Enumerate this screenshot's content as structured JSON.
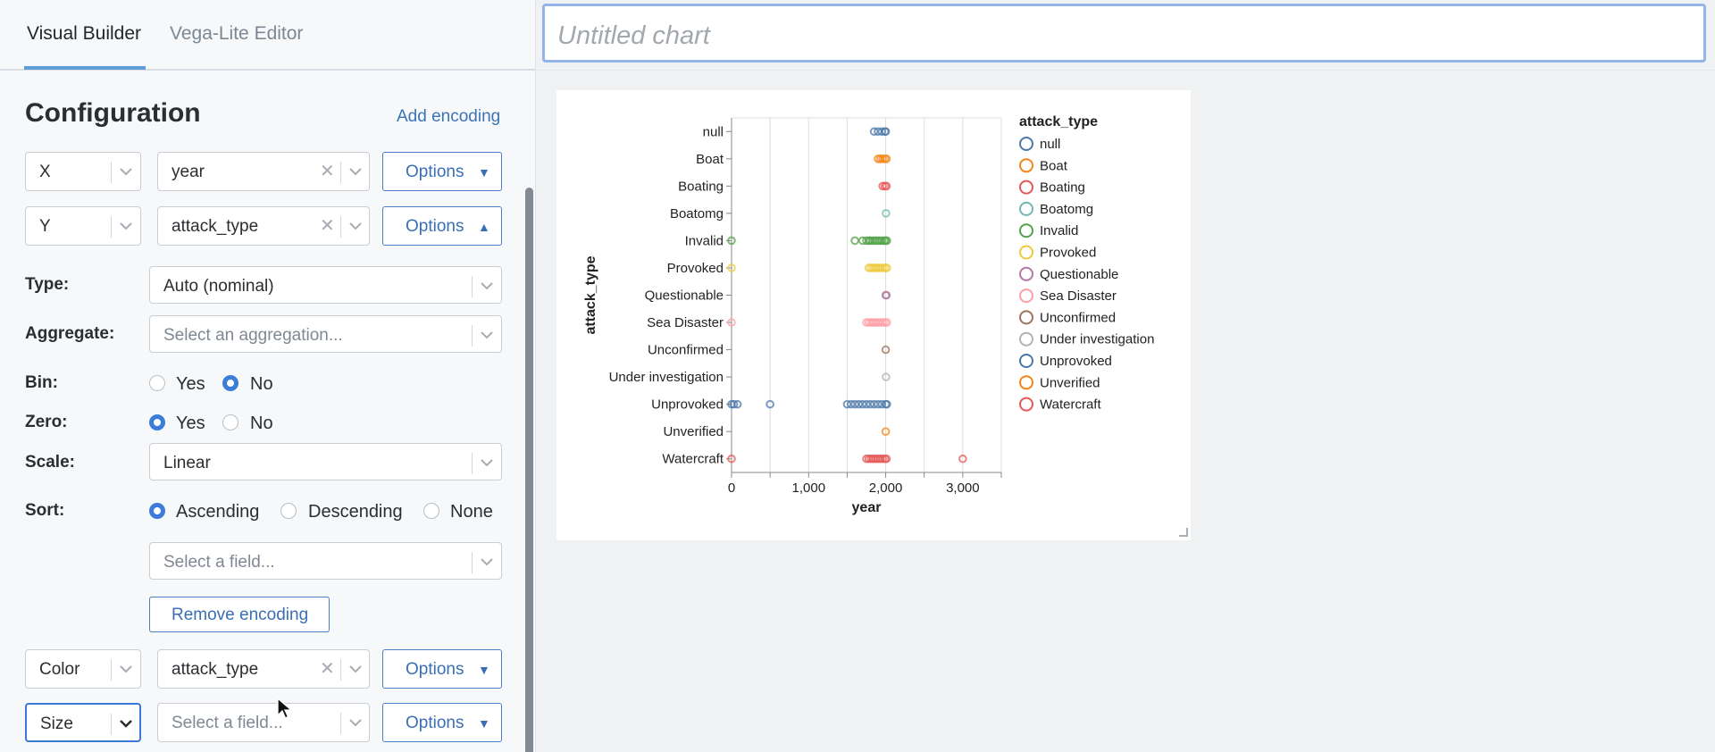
{
  "tabs": {
    "visual": "Visual Builder",
    "vega": "Vega-Lite Editor"
  },
  "config": {
    "title": "Configuration",
    "add_encoding": "Add encoding"
  },
  "encodings": {
    "x": {
      "channel": "X",
      "field": "year",
      "options": "Options"
    },
    "y": {
      "channel": "Y",
      "field": "attack_type",
      "options": "Options"
    },
    "color": {
      "channel": "Color",
      "field": "attack_type",
      "options": "Options"
    },
    "size": {
      "channel": "Size",
      "field_placeholder": "Select a field...",
      "options": "Options"
    }
  },
  "y_options": {
    "type_label": "Type:",
    "type_value": "Auto (nominal)",
    "aggregate_label": "Aggregate:",
    "aggregate_placeholder": "Select an aggregation...",
    "bin_label": "Bin:",
    "bin_yes": "Yes",
    "bin_no": "No",
    "bin_selected": "No",
    "zero_label": "Zero:",
    "zero_yes": "Yes",
    "zero_no": "No",
    "zero_selected": "Yes",
    "scale_label": "Scale:",
    "scale_value": "Linear",
    "sort_label": "Sort:",
    "sort_asc": "Ascending",
    "sort_desc": "Descending",
    "sort_none": "None",
    "sort_selected": "Ascending",
    "sort_field_placeholder": "Select a field...",
    "remove": "Remove encoding"
  },
  "chart_title_placeholder": "Untitled chart",
  "colors": {
    "accent": "#3b7dd8",
    "button_border": "#4a7fc1"
  },
  "chart_data": {
    "type": "scatter",
    "title": "",
    "xlabel": "year",
    "ylabel": "attack_type",
    "xlim": [
      0,
      3500
    ],
    "x_ticks": [
      "0",
      "1,000",
      "2,000",
      "3,000"
    ],
    "legend_title": "attack_type",
    "legend_position": "right",
    "grid": true,
    "categories": [
      "null",
      "Boat",
      "Boating",
      "Boatomg",
      "Invalid",
      "Provoked",
      "Questionable",
      "Sea Disaster",
      "Unconfirmed",
      "Under investigation",
      "Unprovoked",
      "Unverified",
      "Watercraft"
    ],
    "series": [
      {
        "name": "null",
        "color": "#4c78a8",
        "points": [
          1850,
          1900,
          1950,
          1990,
          2000
        ]
      },
      {
        "name": "Boat",
        "color": "#f58518",
        "points": [
          1900,
          1930,
          1960,
          1990,
          2010
        ]
      },
      {
        "name": "Boating",
        "color": "#e45756",
        "points": [
          1960,
          1990,
          2010
        ]
      },
      {
        "name": "Boatomg",
        "color": "#72b7b2",
        "points": [
          2004
        ]
      },
      {
        "name": "Invalid",
        "color": "#54a24b",
        "points": [
          0,
          1600,
          1700,
          1750,
          1780,
          1800,
          1830,
          1860,
          1890,
          1920,
          1950,
          1980,
          2000,
          2015
        ]
      },
      {
        "name": "Provoked",
        "color": "#eeca3b",
        "points": [
          0,
          1780,
          1810,
          1840,
          1870,
          1900,
          1930,
          1960,
          1990,
          2015
        ]
      },
      {
        "name": "Questionable",
        "color": "#b279a2",
        "points": [
          2000,
          2010
        ]
      },
      {
        "name": "Sea Disaster",
        "color": "#ff9da6",
        "points": [
          0,
          1750,
          1780,
          1810,
          1840,
          1870,
          1900,
          1930,
          1960,
          1990,
          2015
        ]
      },
      {
        "name": "Unconfirmed",
        "color": "#9d755d",
        "points": [
          2000
        ]
      },
      {
        "name": "Under investigation",
        "color": "#bab0ac",
        "points": [
          2004
        ]
      },
      {
        "name": "Unprovoked",
        "color": "#4c78a8",
        "points": [
          0,
          30,
          77,
          500,
          1500,
          1550,
          1600,
          1650,
          1700,
          1750,
          1800,
          1850,
          1900,
          1950,
          2000,
          2015
        ]
      },
      {
        "name": "Unverified",
        "color": "#f58518",
        "points": [
          2000
        ]
      },
      {
        "name": "Watercraft",
        "color": "#e45756",
        "points": [
          0,
          1750,
          1780,
          1810,
          1840,
          1870,
          1900,
          1930,
          1960,
          1990,
          2010,
          3000
        ]
      }
    ]
  }
}
